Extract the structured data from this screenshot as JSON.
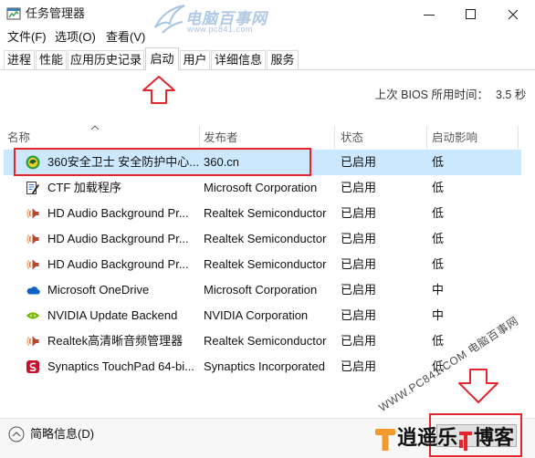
{
  "window": {
    "title": "任务管理器",
    "app_icon": "task-manager-icon",
    "minimize_icon": "minimize-icon",
    "maximize_icon": "maximize-icon",
    "close_icon": "close-icon"
  },
  "watermark_top": {
    "name": "电脑百事网",
    "url": "www.pc841.com"
  },
  "menu": [
    "文件(F)",
    "选项(O)",
    "查看(V)"
  ],
  "tabs": [
    "进程",
    "性能",
    "应用历史记录",
    "启动",
    "用户",
    "详细信息",
    "服务"
  ],
  "active_tab_index": 3,
  "bios": {
    "label": "上次 BIOS 所用时间：",
    "value": "3.5 秒"
  },
  "columns": [
    "名称",
    "发布者",
    "状态",
    "启动影响"
  ],
  "sort_icon": "sort-up-chevron-icon",
  "rows": [
    {
      "icon": "360-safe-icon",
      "name": "360安全卫士 安全防护中心...",
      "publisher": "360.cn",
      "status": "已启用",
      "impact": "低",
      "selected": true
    },
    {
      "icon": "ctf-loader-icon",
      "name": "CTF 加载程序",
      "publisher": "Microsoft Corporation",
      "status": "已启用",
      "impact": "低"
    },
    {
      "icon": "speaker-icon",
      "name": "HD Audio Background Pr...",
      "publisher": "Realtek Semiconductor",
      "status": "已启用",
      "impact": "低"
    },
    {
      "icon": "speaker-icon",
      "name": "HD Audio Background Pr...",
      "publisher": "Realtek Semiconductor",
      "status": "已启用",
      "impact": "低"
    },
    {
      "icon": "speaker-icon",
      "name": "HD Audio Background Pr...",
      "publisher": "Realtek Semiconductor",
      "status": "已启用",
      "impact": "低"
    },
    {
      "icon": "onedrive-icon",
      "name": "Microsoft OneDrive",
      "publisher": "Microsoft Corporation",
      "status": "已启用",
      "impact": "中"
    },
    {
      "icon": "nvidia-icon",
      "name": "NVIDIA Update Backend",
      "publisher": "NVIDIA Corporation",
      "status": "已启用",
      "impact": "中"
    },
    {
      "icon": "speaker-icon",
      "name": "Realtek高清晰音频管理器",
      "publisher": "Realtek Semiconductor",
      "status": "已启用",
      "impact": "低"
    },
    {
      "icon": "synaptics-icon",
      "name": "Synaptics TouchPad 64-bi...",
      "publisher": "Synaptics Incorporated",
      "status": "已启用",
      "impact": "低"
    }
  ],
  "footer": {
    "fewer_details": "简略信息(D)",
    "fewer_details_icon": "chevron-up-circle-icon"
  },
  "watermark_diagonal": "WWW.PC841.COM 电脑百事网",
  "logo": {
    "part1": "逍遥乐",
    "part2": "博客"
  },
  "colors": {
    "selected_row": "#cce8ff",
    "annotation_red": "#e3262d",
    "watermark_blue": "#a8c4e2",
    "logo_orange": "#f39a2b"
  }
}
